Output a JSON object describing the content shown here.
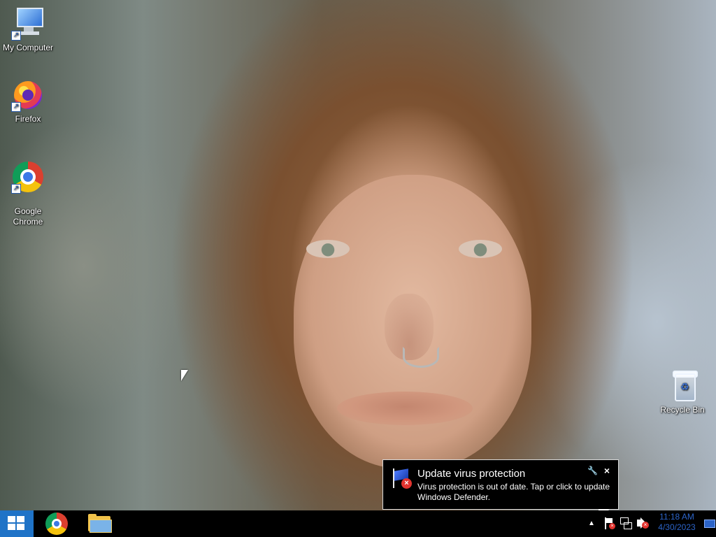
{
  "desktop": {
    "icons": [
      {
        "label": "My Computer",
        "icon": "computer-icon"
      },
      {
        "label": "Firefox",
        "icon": "firefox-icon"
      },
      {
        "label": "Google\nChrome",
        "icon": "chrome-icon"
      },
      {
        "label": "Recycle Bin",
        "icon": "recycle-bin-icon"
      }
    ]
  },
  "notification": {
    "title": "Update virus protection",
    "message": "Virus protection is out of date. Tap or click to update Windows Defender.",
    "settings_icon": "wrench-icon",
    "close_icon": "close-icon"
  },
  "taskbar": {
    "start_icon": "windows-start-icon",
    "apps": [
      {
        "name": "Google Chrome",
        "icon": "chrome-icon"
      },
      {
        "name": "File Explorer",
        "icon": "folder-icon"
      }
    ],
    "tray": {
      "overflow_icon": "chevron-up-icon",
      "action_center_icon": "action-center-warning-icon",
      "network_icon": "network-icon",
      "volume_icon": "muted-speaker-icon",
      "time": "11:18 AM",
      "date": "4/30/2023",
      "desktop_icon": "show-desktop-icon"
    }
  },
  "colors": {
    "taskbar": "#000000",
    "start_button": "#1f73c7",
    "clock": "#2c64c8",
    "error": "#e3342f"
  }
}
